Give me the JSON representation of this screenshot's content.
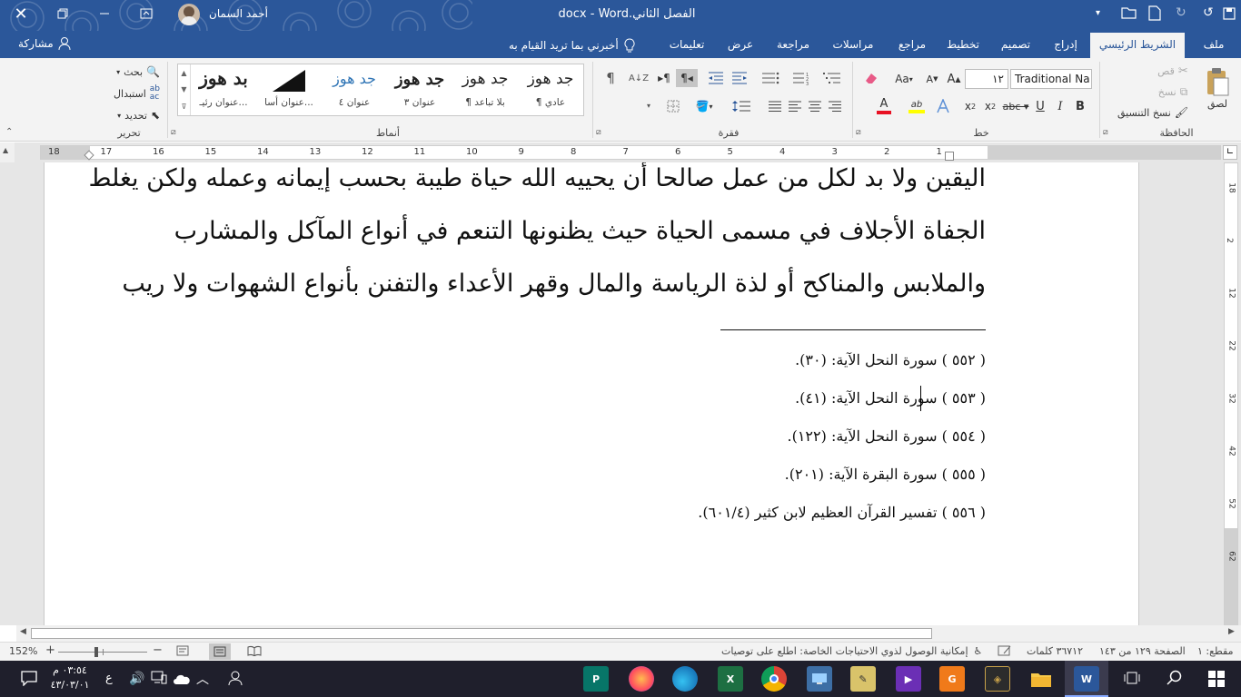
{
  "title": {
    "app": "Word",
    "doc": "الفصل الثاني.docx",
    "user": "أحمد السمان"
  },
  "tabs": [
    "ملف",
    "الشريط الرئيسي",
    "إدراج",
    "تصميم",
    "تخطيط",
    "مراجع",
    "مراسلات",
    "مراجعة",
    "عرض",
    "تعليمات"
  ],
  "tell_me": "أخبرني بما تريد القيام به",
  "share": "مشاركة",
  "clipboard": {
    "paste": "لصق",
    "cut": "قص",
    "copy": "نسخ",
    "format_painter": "نسخ التنسيق",
    "label": "الحافظة"
  },
  "font": {
    "name": "Traditional Na",
    "size": "١٢",
    "label": "خط",
    "bold": "B",
    "italic": "I",
    "underline": "U",
    "grow": "A",
    "shrink": "A",
    "change_case": "Aa",
    "highlight": "ab",
    "font_color": "A",
    "subscript": "x",
    "superscript": "x"
  },
  "paragraph": {
    "label": "فقرة",
    "mark": "¶"
  },
  "styles": {
    "label": "أنماط",
    "items": [
      {
        "preview": "جد هوز",
        "name": "¶ عادي"
      },
      {
        "preview": "جد هوز",
        "name": "¶ بلا تباعد"
      },
      {
        "preview": "جد هوز",
        "name": "عنوان ٣"
      },
      {
        "preview": "جد هوز",
        "name": "عنوان ٤"
      },
      {
        "preview": "",
        "name": "عنوان أسا..."
      },
      {
        "preview": "بد هوز",
        "name": "عنوان رئيـ..."
      }
    ]
  },
  "editing": {
    "label": "تحرير",
    "find": "بحث",
    "replace": "استبدال",
    "select": "تحديد"
  },
  "ruler": {
    "numbers": [
      "18",
      "17",
      "16",
      "15",
      "14",
      "13",
      "12",
      "11",
      "10",
      "9",
      "8",
      "7",
      "6",
      "5",
      "4",
      "3",
      "2",
      "1"
    ],
    "vnumbers": [
      "18",
      "2",
      "12",
      "22",
      "32",
      "42",
      "52",
      "62"
    ]
  },
  "body_lines": [
    "اليقين ولا بد لكل من عمل صالحا أن يحييه الله حياة طيبة بحسب إيمانه وعمله ولكن يغلط",
    "الجفاة الأجلاف في مسمى الحياة حيث يظنونها التنعم في أنواع المآكل والمشارب",
    "والملابس والمناكح أو لذة الرياسة والمال وقهر الأعداء والتفنن بأنواع الشهوات ولا ريب"
  ],
  "footnotes": [
    "( ٥٥٢ ) سورة النحل الآية: (٣٠).",
    "( ٥٥٣ ) سورة النحل الآية: (٤١).",
    "( ٥٥٤ ) سورة النحل الآية: (١٢٢).",
    "( ٥٥٥ ) سورة البقرة الآية: (٢٠١).",
    "( ٥٥٦ ) تفسير القرآن العظيم لابن كثير (٦٠١/٤)."
  ],
  "status": {
    "section": "مقطع: ١",
    "page": "الصفحة ١٢٩ من ١٤٣",
    "words": "٣٦٧١٢ كلمات",
    "accessibility": "إمكانية الوصول لذوي الاحتياجات الخاصة: اطلع على توصيات",
    "zoom": "152%"
  },
  "taskbar": {
    "time": "٠٣:٥٤ م",
    "date": "٤٣/٠٣/٠١",
    "lang": "ع"
  },
  "colors": {
    "accent": "#2b579a",
    "taskbar": "#1f1f2c"
  }
}
